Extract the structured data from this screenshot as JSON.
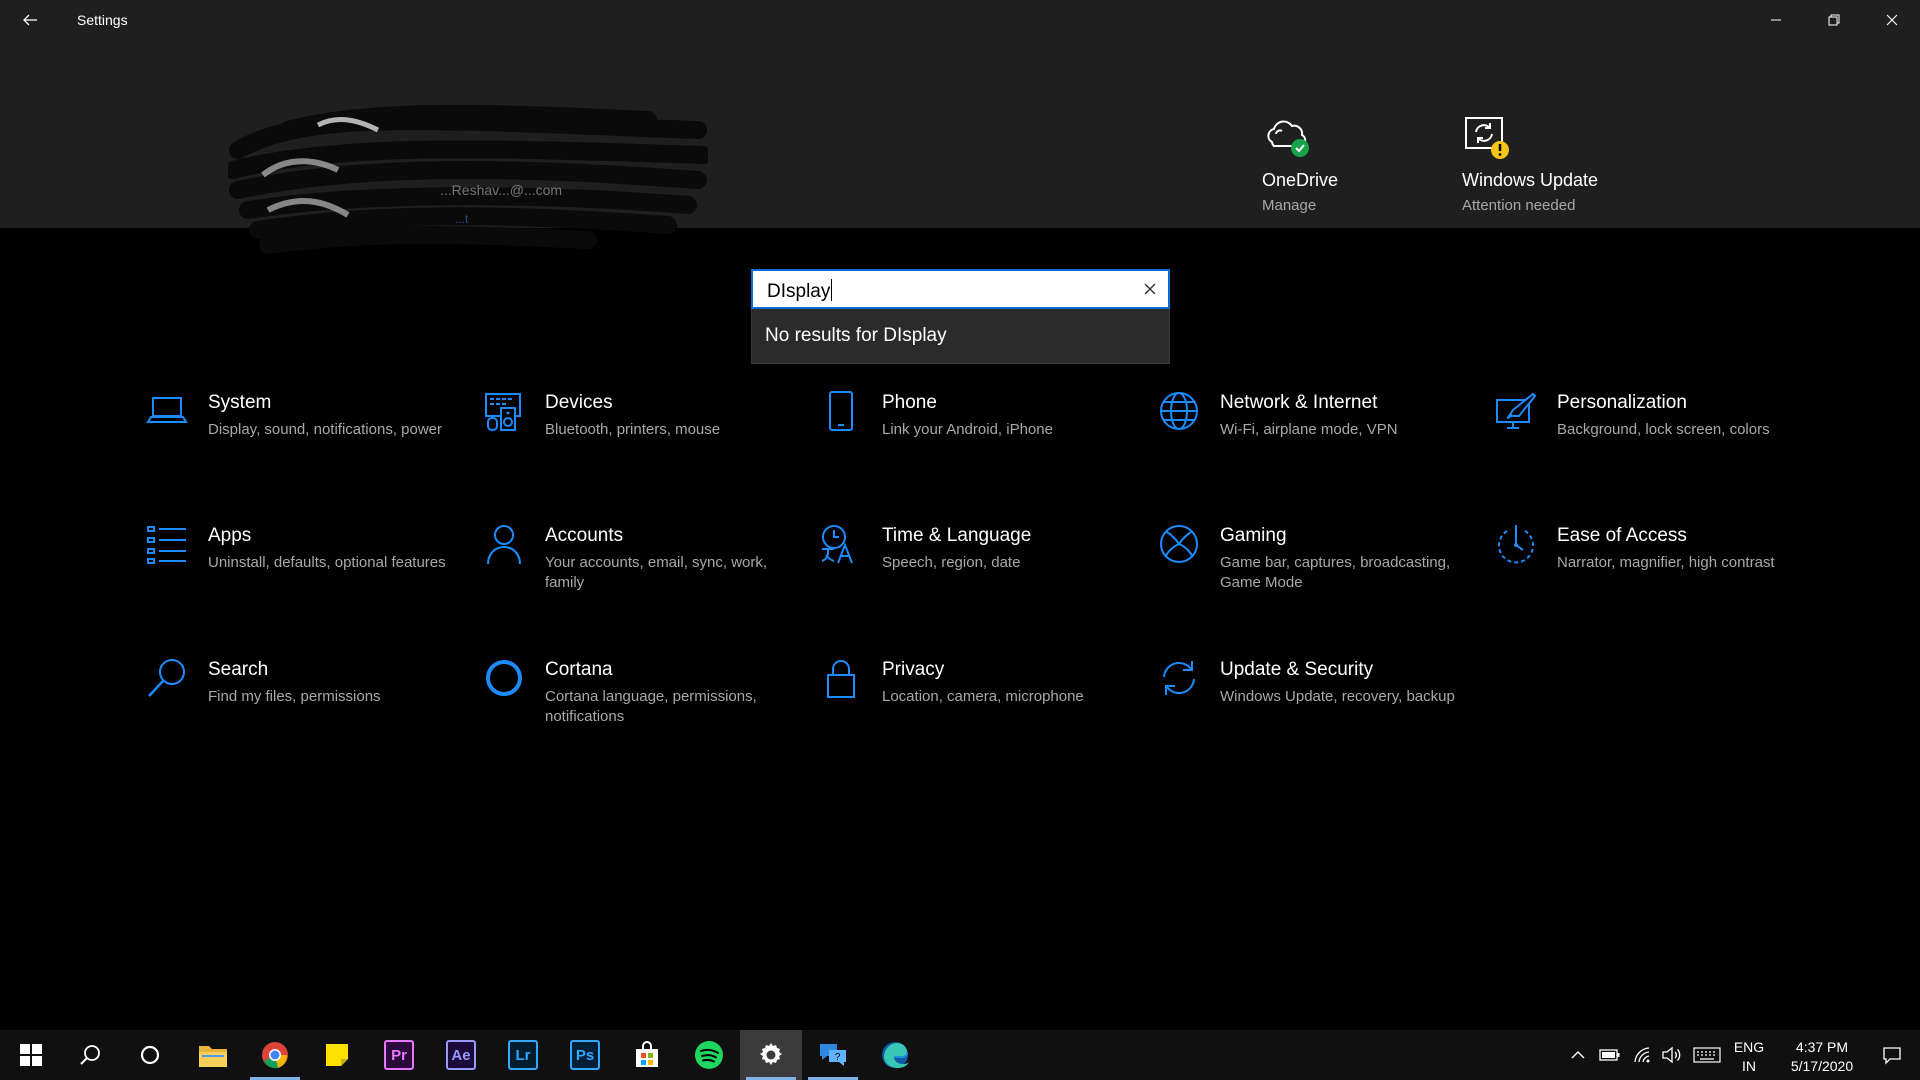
{
  "window": {
    "title": "Settings",
    "controls": {
      "minimize": "minimize",
      "maximize": "restore",
      "close": "close"
    }
  },
  "account": {
    "email": "...Reshav...@...com",
    "link": "...t",
    "redacted": true
  },
  "header_tiles": [
    {
      "name": "OneDrive",
      "subtitle": "Manage",
      "icon": "onedrive-cloud-icon",
      "status": "ok",
      "status_color": "#16a34a"
    },
    {
      "name": "Windows Update",
      "subtitle": "Attention needed",
      "icon": "windows-update-icon",
      "status": "warning",
      "status_color": "#f5c518"
    }
  ],
  "search": {
    "value": "DIsplay",
    "no_results": "No results for DIsplay"
  },
  "categories": [
    {
      "title": "System",
      "description": "Display, sound, notifications, power",
      "icon": "laptop-icon"
    },
    {
      "title": "Devices",
      "description": "Bluetooth, printers, mouse",
      "icon": "devices-icon"
    },
    {
      "title": "Phone",
      "description": "Link your Android, iPhone",
      "icon": "phone-icon"
    },
    {
      "title": "Network & Internet",
      "description": "Wi-Fi, airplane mode, VPN",
      "icon": "globe-icon"
    },
    {
      "title": "Personalization",
      "description": "Background, lock screen, colors",
      "icon": "paint-icon"
    },
    {
      "title": "Apps",
      "description": "Uninstall, defaults, optional features",
      "icon": "apps-list-icon"
    },
    {
      "title": "Accounts",
      "description": "Your accounts, email, sync, work, family",
      "icon": "person-icon"
    },
    {
      "title": "Time & Language",
      "description": "Speech, region, date",
      "icon": "time-language-icon"
    },
    {
      "title": "Gaming",
      "description": "Game bar, captures, broadcasting, Game Mode",
      "icon": "xbox-icon"
    },
    {
      "title": "Ease of Access",
      "description": "Narrator, magnifier, high contrast",
      "icon": "ease-of-access-icon"
    },
    {
      "title": "Search",
      "description": "Find my files, permissions",
      "icon": "magnifier-icon"
    },
    {
      "title": "Cortana",
      "description": "Cortana language, permissions, notifications",
      "icon": "cortana-icon"
    },
    {
      "title": "Privacy",
      "description": "Location, camera, microphone",
      "icon": "lock-icon"
    },
    {
      "title": "Update & Security",
      "description": "Windows Update, recovery, backup",
      "icon": "sync-icon"
    }
  ],
  "taskbar": {
    "apps": [
      {
        "name": "Start",
        "icon": "windows-logo-icon"
      },
      {
        "name": "Search",
        "icon": "search-icon"
      },
      {
        "name": "Cortana",
        "icon": "cortana-circle-icon"
      },
      {
        "name": "File Explorer",
        "icon": "folder-icon"
      },
      {
        "name": "Google Chrome",
        "icon": "chrome-icon",
        "running": true
      },
      {
        "name": "Sticky Notes",
        "icon": "sticky-notes-icon"
      },
      {
        "name": "Premiere Pro",
        "label": "Pr",
        "icon": "premiere-icon"
      },
      {
        "name": "After Effects",
        "label": "Ae",
        "icon": "after-effects-icon"
      },
      {
        "name": "Lightroom",
        "label": "Lr",
        "icon": "lightroom-icon"
      },
      {
        "name": "Photoshop",
        "label": "Ps",
        "icon": "photoshop-icon"
      },
      {
        "name": "Microsoft Store",
        "icon": "store-icon"
      },
      {
        "name": "Spotify",
        "icon": "spotify-icon"
      },
      {
        "name": "Settings",
        "icon": "gear-icon",
        "running": true,
        "active": true
      },
      {
        "name": "Get Help",
        "icon": "help-icon",
        "running": true
      },
      {
        "name": "Microsoft Edge",
        "icon": "edge-icon"
      }
    ],
    "tray": {
      "icons": [
        "chevron-up-icon",
        "battery-icon",
        "wifi-icon",
        "volume-icon",
        "keyboard-icon"
      ],
      "language_line1": "ENG",
      "language_line2": "IN",
      "time": "4:37 PM",
      "date": "5/17/2020"
    }
  },
  "colors": {
    "accent": "#1a8cff",
    "header_bg": "#1f1f1f",
    "page_bg": "#000000",
    "search_border": "#0a6fd4",
    "secondary_text": "#a8a8a8"
  }
}
